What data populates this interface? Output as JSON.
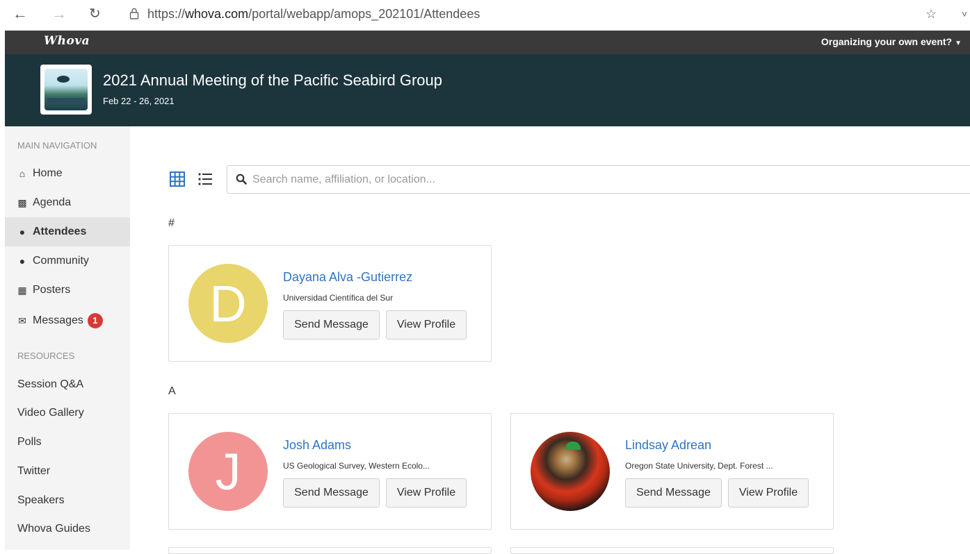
{
  "browser": {
    "url_scheme": "https://",
    "url_host": "whova.com",
    "url_path": "/portal/webapp/amops_202101/Attendees"
  },
  "top_strip": {
    "logo": "Whova",
    "organize_link": "Organizing your own event?"
  },
  "event": {
    "title": "2021 Annual Meeting of the Pacific Seabird Group",
    "dates": "Feb 22 - 26, 2021"
  },
  "sidebar": {
    "main_heading": "MAIN NAVIGATION",
    "main_items": [
      {
        "label": "Home",
        "icon": "home-icon"
      },
      {
        "label": "Agenda",
        "icon": "calendar-icon"
      },
      {
        "label": "Attendees",
        "icon": "users-icon",
        "active": true
      },
      {
        "label": "Community",
        "icon": "comments-icon"
      },
      {
        "label": "Posters",
        "icon": "building-icon"
      },
      {
        "label": "Messages",
        "icon": "envelope-icon",
        "badge": "1"
      }
    ],
    "resources_heading": "RESOURCES",
    "resource_items": [
      "Session Q&A",
      "Video Gallery",
      "Polls",
      "Twitter",
      "Speakers",
      "Whova Guides"
    ]
  },
  "main": {
    "search_placeholder": "Search name, affiliation, or location...",
    "groups": [
      {
        "letter": "#",
        "attendees": [
          {
            "name": "Dayana Alva -Gutierrez",
            "affiliation": "Universidad Científica del Sur",
            "initial": "D",
            "avatar_color": "#e8d56b"
          }
        ]
      },
      {
        "letter": "A",
        "attendees": [
          {
            "name": "Josh Adams",
            "affiliation": "US Geological Survey, Western Ecolo...",
            "initial": "J",
            "avatar_color": "#f29494"
          },
          {
            "name": "Lindsay Adrean",
            "affiliation": "Oregon State University, Dept. Forest ...",
            "initial": "",
            "avatar_color": "photo"
          }
        ]
      }
    ],
    "send_label": "Send Message",
    "view_label": "View Profile"
  }
}
